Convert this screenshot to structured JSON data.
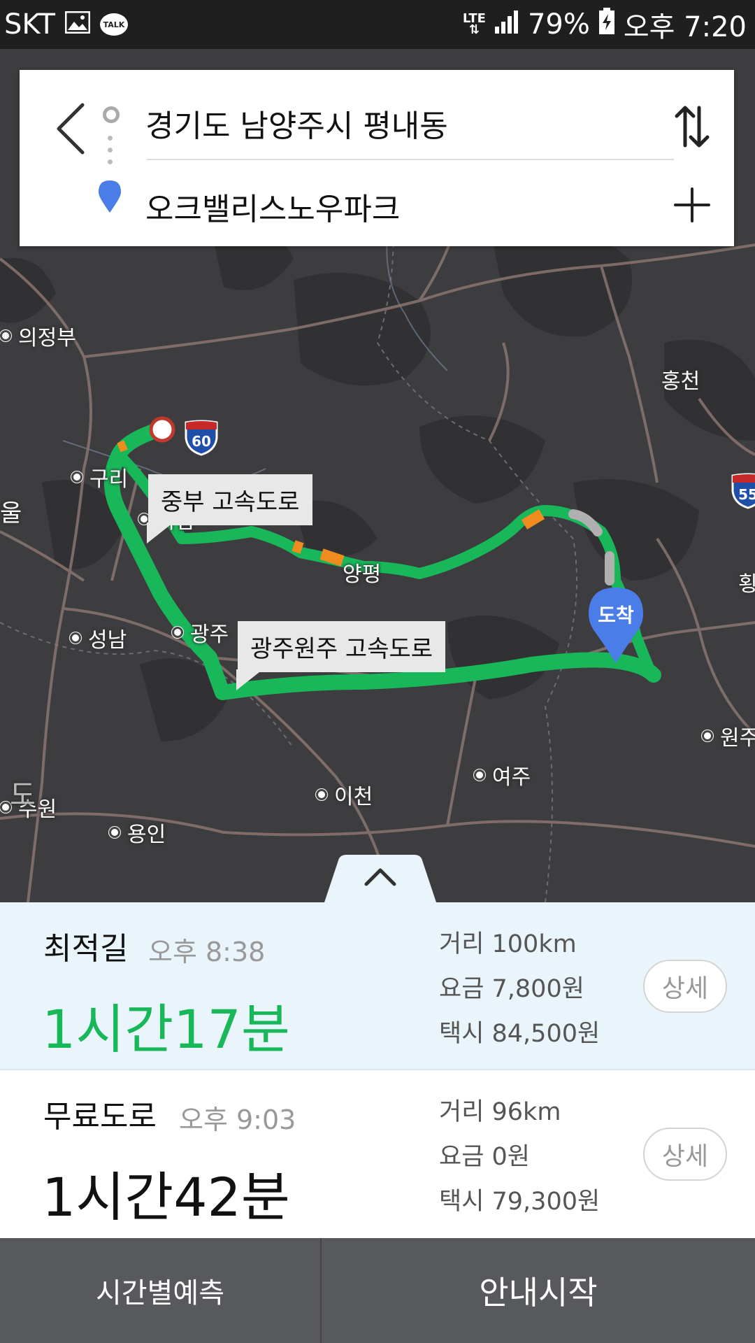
{
  "status_bar": {
    "carrier": "SKT",
    "talk_badge": "TALK",
    "network": "LTE",
    "battery": "79%",
    "time": "오후 7:20"
  },
  "search": {
    "origin": "경기도 남양주시 평내동",
    "destination": "오크밸리스노우파크"
  },
  "map": {
    "places": [
      {
        "name": "의정부"
      },
      {
        "name": "홍천"
      },
      {
        "name": "구리"
      },
      {
        "name": "하남"
      },
      {
        "name": "양평"
      },
      {
        "name": "성남"
      },
      {
        "name": "광주"
      },
      {
        "name": "원주"
      },
      {
        "name": "여주"
      },
      {
        "name": "이천"
      },
      {
        "name": "수원"
      },
      {
        "name": "용인"
      }
    ],
    "edge_labels": {
      "left_1": "울",
      "left_2": "도",
      "right_1": "횡"
    },
    "highway_shields": [
      "60",
      "55"
    ],
    "road_callouts": [
      "중부 고속도로",
      "광주원주 고속도로"
    ],
    "arrival_pin": "도착",
    "route_color": "#18b85a",
    "congestion_color": "#f08c1e"
  },
  "routes": [
    {
      "type": "최적길",
      "arrival": "오후 8:38",
      "duration": "1시간17분",
      "distance": "거리 100km",
      "fare": "요금 7,800원",
      "taxi": "택시 84,500원",
      "detail_label": "상세"
    },
    {
      "type": "무료도로",
      "arrival": "오후 9:03",
      "duration": "1시간42분",
      "distance": "거리 96km",
      "fare": "요금 0원",
      "taxi": "택시 79,300원",
      "detail_label": "상세"
    }
  ],
  "bottom_bar": {
    "time_prediction": "시간별예측",
    "start_guidance": "안내시작"
  }
}
